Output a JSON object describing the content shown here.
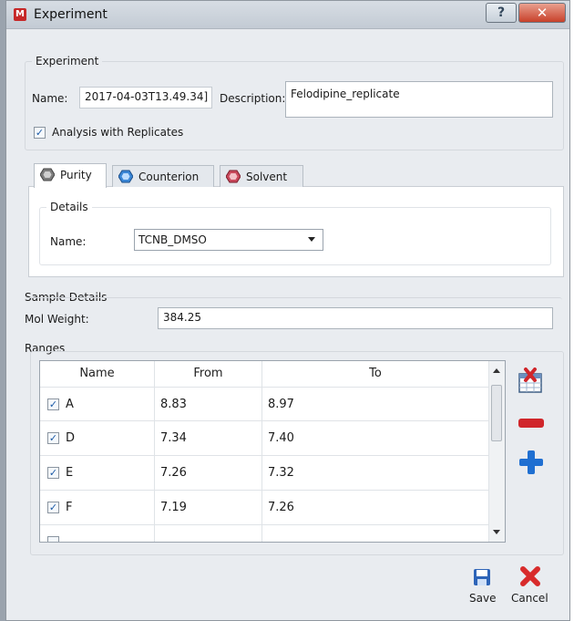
{
  "window": {
    "title": "Experiment",
    "help_glyph": "?",
    "close_glyph": "✕"
  },
  "experiment": {
    "group_label": "Experiment",
    "name_label": "Name:",
    "name_value": "2017-04-03T13.49.34]",
    "description_label": "Description:",
    "description_value": "Felodipine_replicate",
    "replicates_label": "Analysis with Replicates",
    "replicates_checked": true
  },
  "tabs": [
    {
      "label": "Purity",
      "active": true,
      "icon": "gray-hexagon-icon",
      "color": "#7d7d7d"
    },
    {
      "label": "Counterion",
      "active": false,
      "icon": "blue-hexagon-icon",
      "color": "#3a86d6"
    },
    {
      "label": "Solvent",
      "active": false,
      "icon": "red-hexagon-icon",
      "color": "#c9485b"
    }
  ],
  "details": {
    "group_label": "Details",
    "name_label": "Name:",
    "selected_value": "TCNB_DMSO"
  },
  "sample": {
    "group_label": "Sample Details",
    "mol_weight_label": "Mol Weight:",
    "mol_weight_value": "384.25"
  },
  "ranges": {
    "group_label": "Ranges",
    "columns": [
      "Name",
      "From",
      "To"
    ],
    "rows": [
      {
        "checked": true,
        "name": "A",
        "from": "8.83",
        "to": "8.97"
      },
      {
        "checked": true,
        "name": "D",
        "from": "7.34",
        "to": "7.40"
      },
      {
        "checked": true,
        "name": "E",
        "from": "7.26",
        "to": "7.32"
      },
      {
        "checked": true,
        "name": "F",
        "from": "7.19",
        "to": "7.26"
      }
    ]
  },
  "actions": {
    "save_label": "Save",
    "cancel_label": "Cancel"
  },
  "colors": {
    "accent_blue": "#1f6fd1",
    "remove_red": "#d0262b",
    "cancel_red": "#d82b2b"
  }
}
